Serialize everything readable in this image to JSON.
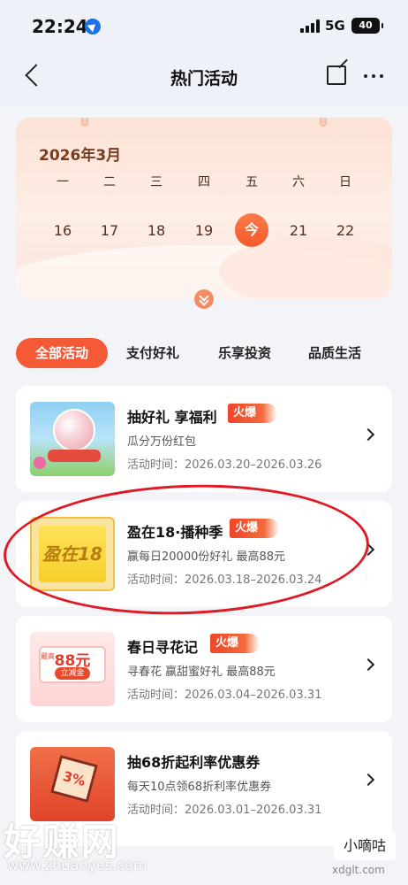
{
  "status_bar": {
    "time": "22:24",
    "network": "5G",
    "battery": "40",
    "icons": [
      "location-arrow-icon",
      "signal-bars-icon",
      "battery-icon"
    ]
  },
  "nav": {
    "title": "热门活动",
    "icons": [
      "back-chevron-icon",
      "share-icon",
      "more-dots-icon"
    ]
  },
  "calendar": {
    "month": "2026年3月",
    "weekdays": [
      "一",
      "二",
      "三",
      "四",
      "五",
      "六",
      "日"
    ],
    "dates": [
      "16",
      "17",
      "18",
      "19",
      "今",
      "21",
      "22"
    ],
    "today_label": "今",
    "accent_color": "#f35a2a"
  },
  "tabs": [
    {
      "label": "全部活动",
      "active": true
    },
    {
      "label": "支付好礼",
      "active": false
    },
    {
      "label": "乐享投资",
      "active": false
    },
    {
      "label": "品质生活",
      "active": false
    }
  ],
  "activities": [
    {
      "title": "抽好礼 享福利",
      "badge": "火爆",
      "subtitle": "瓜分万份红包",
      "time_label": "活动时间：",
      "time_range": "2026.03.20–2026.03.26"
    },
    {
      "title": "盈在18·播种季",
      "badge": "火爆",
      "subtitle": "赢每日20000份好礼 最高88元",
      "time_label": "活动时间：",
      "time_range": "2026.03.18–2026.03.24",
      "thumb_text": "盈在18"
    },
    {
      "title": "春日寻花记",
      "badge": "火爆",
      "subtitle": "寻春花 赢甜蜜好礼 最高88元",
      "time_label": "活动时间：",
      "time_range": "2026.03.04–2026.03.31",
      "thumb_amount": "88元",
      "thumb_small": "最高",
      "thumb_label": "立减金"
    },
    {
      "title": "抽68折起利率优惠券",
      "subtitle": "每天10点领68折利率优惠券",
      "time_label": "活动时间：",
      "time_range": "2026.03.01–2026.03.31",
      "thumb_text": "3%"
    }
  ],
  "watermark": {
    "left_text": "好赚网",
    "left_url": "www.zhuanyes.com",
    "right_text": "小嘀咕",
    "right_url": "xdglt.com"
  }
}
